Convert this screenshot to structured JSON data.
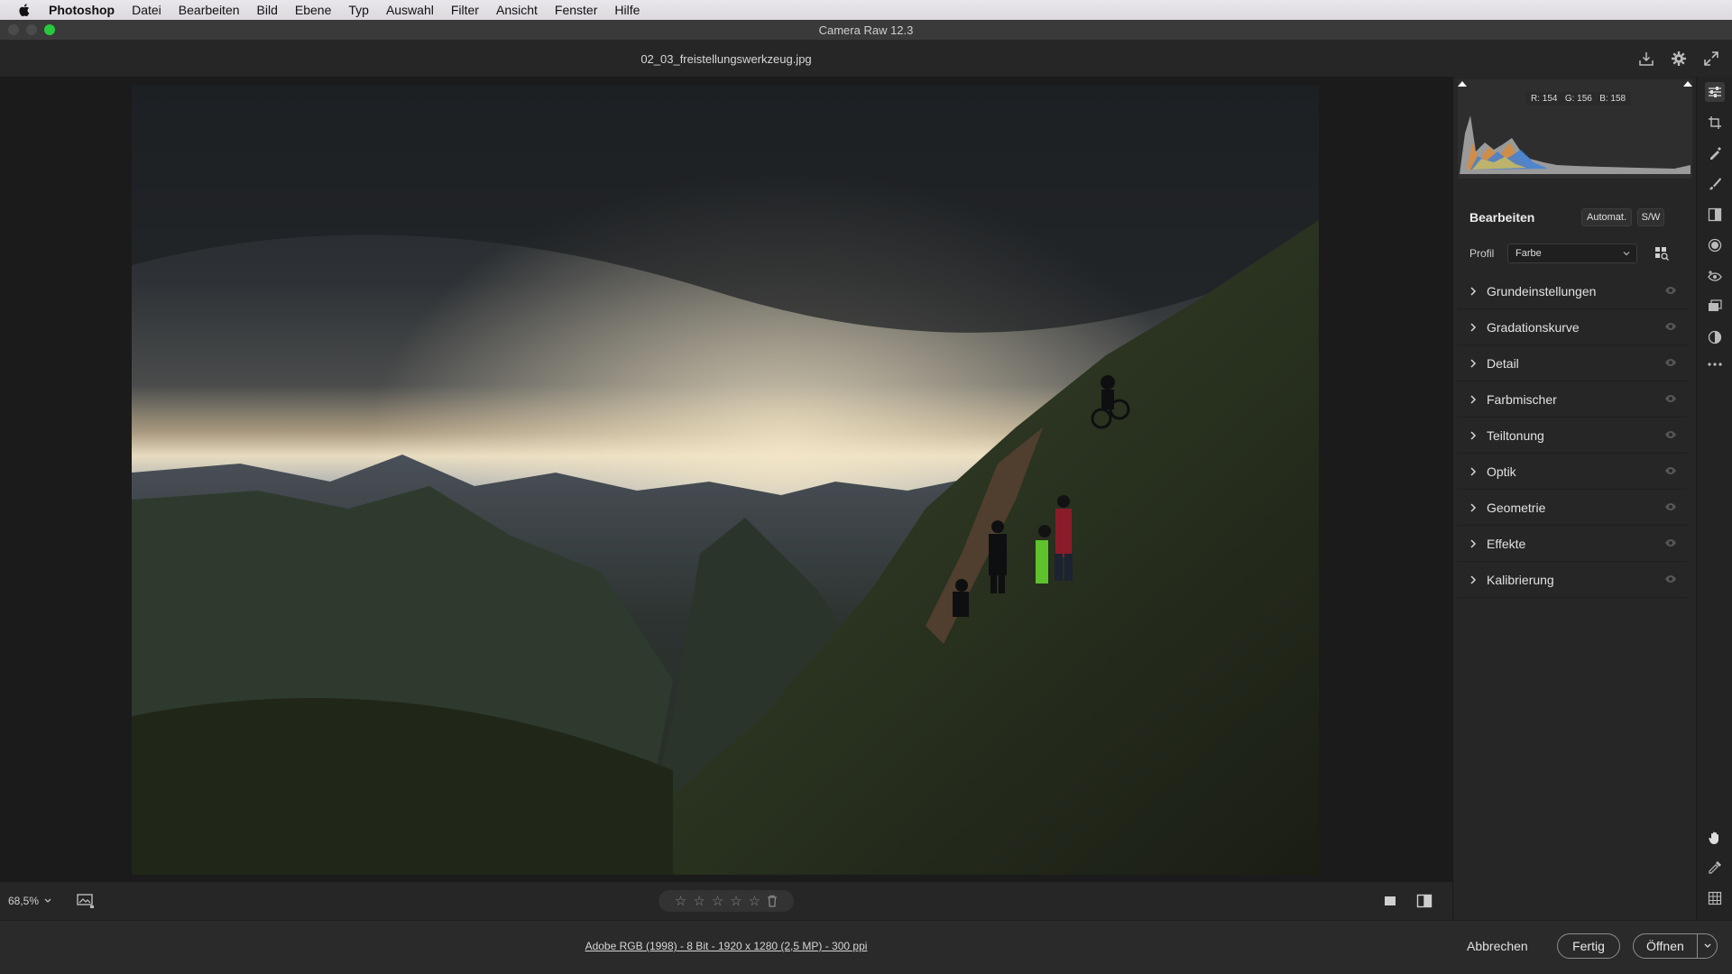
{
  "menubar": {
    "app": "Photoshop",
    "items": [
      "Datei",
      "Bearbeiten",
      "Bild",
      "Ebene",
      "Typ",
      "Auswahl",
      "Filter",
      "Ansicht",
      "Fenster",
      "Hilfe"
    ]
  },
  "window": {
    "title": "Camera Raw 12.3"
  },
  "file": {
    "name": "02_03_freistellungswerkzeug.jpg"
  },
  "histogram": {
    "r": "R: 154",
    "g": "G: 156",
    "b": "B: 158"
  },
  "panel": {
    "title": "Bearbeiten",
    "auto_label": "Automat.",
    "bw_label": "S/W",
    "profile_label": "Profil",
    "profile_value": "Farbe",
    "sections": [
      "Grundeinstellungen",
      "Gradationskurve",
      "Detail",
      "Farbmischer",
      "Teiltonung",
      "Optik",
      "Geometrie",
      "Effekte",
      "Kalibrierung"
    ]
  },
  "bottom": {
    "zoom": "68,5%"
  },
  "footer": {
    "info": "Adobe RGB (1998) - 8 Bit - 1920 x 1280 (2,5 MP) - 300 ppi",
    "cancel": "Abbrechen",
    "done": "Fertig",
    "open": "Öffnen"
  },
  "colors": {
    "accent_green": "#27c93f",
    "panel_bg": "#262626",
    "canvas_bg": "#1b1b1b"
  },
  "icons": [
    "apple-icon",
    "save-icon",
    "gear-icon",
    "fullscreen-icon",
    "edit-icon",
    "crop-icon",
    "healing-icon",
    "brush-icon",
    "gradient-icon",
    "radial-icon",
    "redeye-icon",
    "presets-icon",
    "mask-icon",
    "more-icon",
    "hand-icon",
    "eyedropper-icon",
    "grid-icon"
  ]
}
